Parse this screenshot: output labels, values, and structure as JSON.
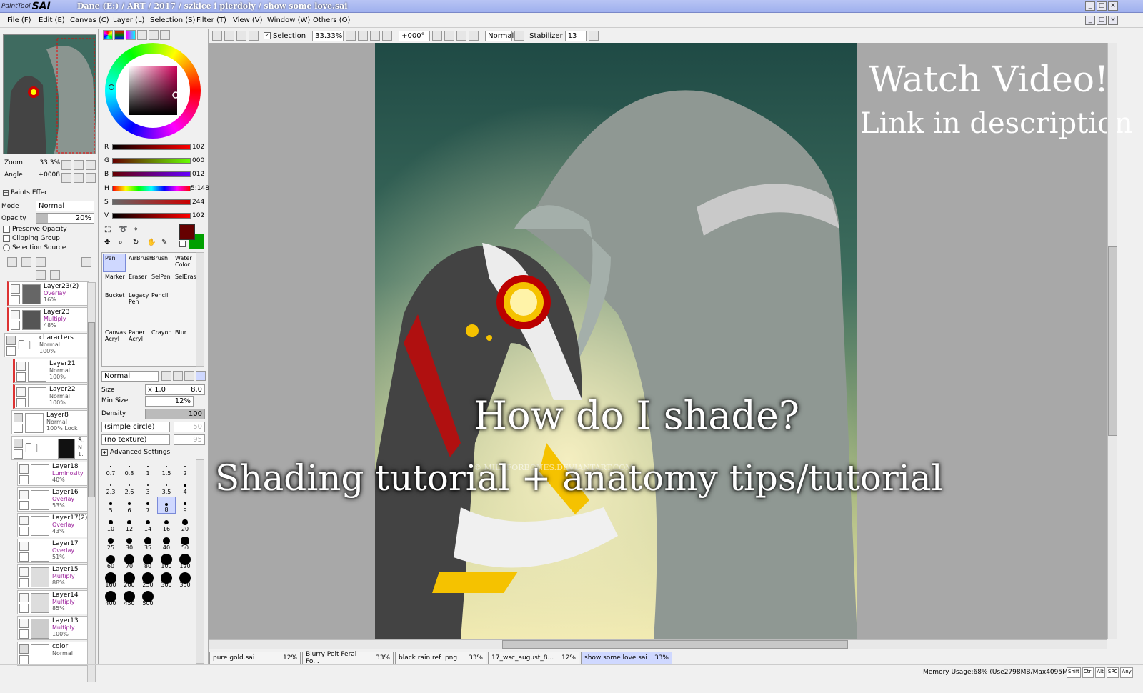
{
  "app": {
    "logo_prefix": "PaintTool",
    "logo_name": "SAI",
    "title": "Dane (E:) / ART / 2017 / szkice i pierdoły / show some love.sai"
  },
  "menu": [
    "File (F)",
    "Edit (E)",
    "Canvas (C)",
    "Layer (L)",
    "Selection (S)",
    "Filter (T)",
    "View (V)",
    "Window (W)",
    "Others (O)"
  ],
  "toolbar": {
    "selection_label": "Selection",
    "zoom": "33.33%",
    "rotation": "+000°",
    "mode": "Normal",
    "stabilizer_label": "Stabilizer",
    "stabilizer": "13"
  },
  "navigator": {
    "zoom_label": "Zoom",
    "zoom_value": "33.3%",
    "angle_label": "Angle",
    "angle_value": "+0008"
  },
  "paints_effect": {
    "title": "Paints Effect",
    "mode_label": "Mode",
    "mode_value": "Normal",
    "opacity_label": "Opacity",
    "opacity_value": "20%"
  },
  "layer_options": [
    "Preserve Opacity",
    "Clipping Group",
    "Selection Source"
  ],
  "layers": [
    {
      "name": "Layer23(2)",
      "mode": "Overlay",
      "opacity": "16%"
    },
    {
      "name": "Layer23",
      "mode": "Multiply",
      "opacity": "48%"
    },
    {
      "name": "characters",
      "mode": "Normal",
      "opacity": "100%"
    },
    {
      "name": "Layer21",
      "mode": "Normal",
      "opacity": "100%"
    },
    {
      "name": "Layer22",
      "mode": "Normal",
      "opacity": "100%"
    },
    {
      "name": "Layer8",
      "mode": "Normal",
      "opacity": "100% Lock"
    },
    {
      "name": "S.",
      "mode": "N.",
      "opacity": "1."
    },
    {
      "name": "Layer18",
      "mode": "Luminosity",
      "opacity": "40%"
    },
    {
      "name": "Layer16",
      "mode": "Overlay",
      "opacity": "53%"
    },
    {
      "name": "Layer17(2)",
      "mode": "Overlay",
      "opacity": "43%"
    },
    {
      "name": "Layer17",
      "mode": "Overlay",
      "opacity": "51%"
    },
    {
      "name": "Layer15",
      "mode": "Multiply",
      "opacity": "88%"
    },
    {
      "name": "Layer14",
      "mode": "Multiply",
      "opacity": "85%"
    },
    {
      "name": "Layer13",
      "mode": "Multiply",
      "opacity": "100%"
    },
    {
      "name": "color",
      "mode": "Normal",
      "opacity": ""
    }
  ],
  "color": {
    "r": "102",
    "g": "000",
    "b": "012",
    "h": "5:148",
    "s": "244",
    "v": "102",
    "primary": "#660000",
    "secondary": "#00a000"
  },
  "tools": [
    "Pen",
    "AirBrush",
    "Brush",
    "Water Color",
    "Marker",
    "Eraser",
    "SelPen",
    "SelEras",
    "Bucket",
    "Legacy Pen",
    "Pencil",
    "",
    "Canvas Acryl",
    "Paper Acryl",
    "Crayon",
    "Blur"
  ],
  "brush": {
    "blend": "Normal",
    "size_label": "Size",
    "size_mult": "x 1.0",
    "size": "8.0",
    "minsize_label": "Min Size",
    "minsize": "12%",
    "density_label": "Density",
    "density": "100",
    "shape": "(simple circle)",
    "shape_val": "50",
    "texture": "(no texture)",
    "texture_val": "95",
    "advanced": "Advanced Settings"
  },
  "brush_sizes": [
    "0.7",
    "0.8",
    "1",
    "1.5",
    "2",
    "2.3",
    "2.6",
    "3",
    "3.5",
    "4",
    "5",
    "6",
    "7",
    "8",
    "9",
    "10",
    "12",
    "14",
    "16",
    "20",
    "25",
    "30",
    "35",
    "40",
    "50",
    "60",
    "70",
    "80",
    "100",
    "120",
    "160",
    "200",
    "250",
    "300",
    "350",
    "400",
    "450",
    "500"
  ],
  "canvas_text": {
    "watch": "Watch Video!",
    "link": "Link in description",
    "how": "How do I shade?",
    "tutorial": "Shading tutorial + anatomy tips/tutorial",
    "watermark": "© MILKFORBONES.DEVIANTART.COM"
  },
  "tabs": [
    {
      "name": "pure gold.sai",
      "zoom": "12%"
    },
    {
      "name": "Blurry Pelt Feral Fo...",
      "zoom": "33%"
    },
    {
      "name": "black rain ref .png",
      "zoom": "33%"
    },
    {
      "name": "17_wsc_august_8...",
      "zoom": "12%"
    },
    {
      "name": "show some love.sai",
      "zoom": "33%"
    }
  ],
  "status": {
    "memory": "Memory Usage:68% (Use2798MB/Max4095MB)",
    "keys": [
      "Shift",
      "Ctrl",
      "Alt",
      "SPC",
      "Any"
    ]
  }
}
